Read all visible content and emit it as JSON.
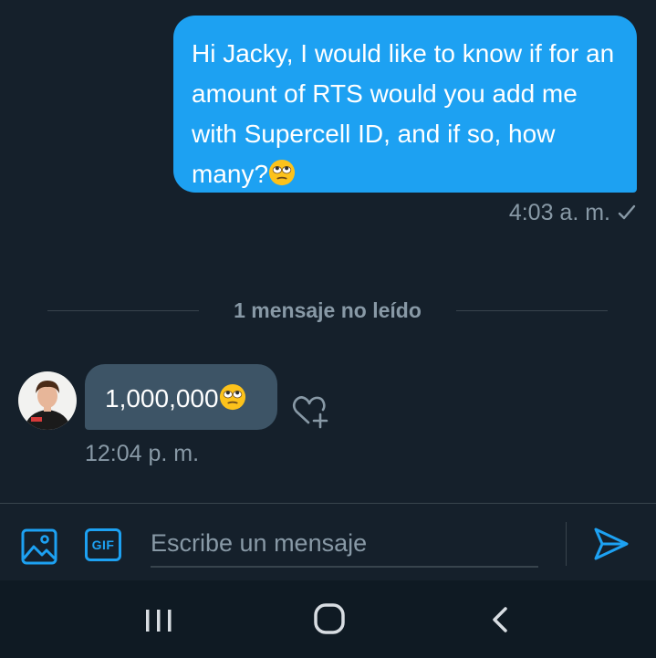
{
  "conversation": {
    "outgoing": {
      "text": "Hi Jacky, I would like to know if for an amount of RTS would you add me with Supercell ID, and if so, how many?",
      "emoji": "face-with-rolling-eyes",
      "time": "4:03 a. m.",
      "status_icon": "check-icon"
    },
    "unread_divider": "1 mensaje no leído",
    "incoming": {
      "text": "1,000,000",
      "emoji": "face-with-rolling-eyes",
      "time": "12:04 p. m.",
      "reaction_icon": "heart-plus-icon"
    }
  },
  "composer": {
    "placeholder": "Escribe un mensaje",
    "image_icon": "image-icon",
    "gif_label": "GIF",
    "send_icon": "send-icon"
  },
  "navbar": {
    "recents_icon": "recents-icon",
    "home_icon": "home-icon",
    "back_icon": "back-icon"
  },
  "colors": {
    "background": "#15202b",
    "accent": "#1da1f2",
    "incoming_bubble": "#3d5466",
    "secondary_text": "#8899a6",
    "divider": "#38444d",
    "navbar": "#0f1a23"
  }
}
